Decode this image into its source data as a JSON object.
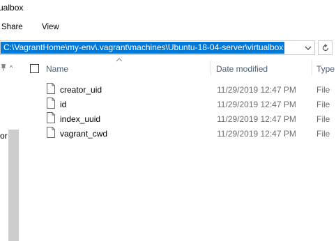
{
  "window": {
    "title": "ualbox"
  },
  "ribbon": {
    "tabs": [
      "Share",
      "View"
    ]
  },
  "address_bar": {
    "path": "C:\\VagrantHome\\my-env\\.vagrant\\machines\\Ubuntu-18-04-server\\virtualbox"
  },
  "nav_pane": {
    "partial_text": "or"
  },
  "columns": {
    "name": "Name",
    "date_modified": "Date modified",
    "type": "Type"
  },
  "files": [
    {
      "name": "creator_uid",
      "date": "11/29/2019 12:47 PM",
      "type": "File"
    },
    {
      "name": "id",
      "date": "11/29/2019 12:47 PM",
      "type": "File"
    },
    {
      "name": "index_uuid",
      "date": "11/29/2019 12:47 PM",
      "type": "File"
    },
    {
      "name": "vagrant_cwd",
      "date": "11/29/2019 12:47 PM",
      "type": "File"
    }
  ],
  "icons": [
    "chevron-down-icon",
    "refresh-icon",
    "pin-icon",
    "sort-ascending-icon",
    "file-icon"
  ]
}
